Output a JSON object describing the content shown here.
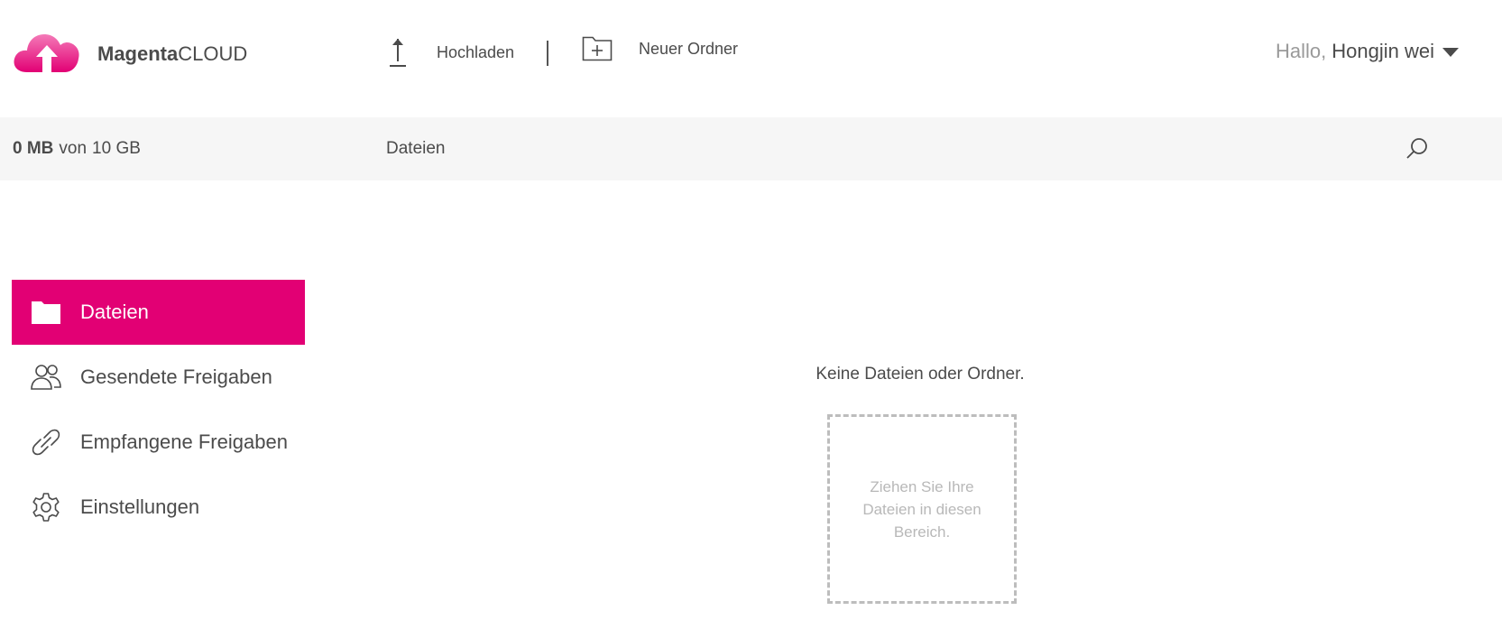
{
  "brand": {
    "name_bold": "Magenta",
    "name_light": "CLOUD",
    "accent_color": "#e20074",
    "logo_icon": "cloud-upload-icon"
  },
  "toolbar": {
    "upload_label": "Hochladen",
    "upload_icon": "upload-arrow-icon",
    "new_folder_label": "Neuer Ordner",
    "new_folder_icon": "folder-plus-icon"
  },
  "user": {
    "greeting": "Hallo,",
    "name": "Hongjin wei",
    "menu_icon": "caret-down-icon"
  },
  "quota": {
    "used": "0 MB",
    "of": "von",
    "total": "10 GB"
  },
  "breadcrumb": {
    "current": "Dateien"
  },
  "search": {
    "icon": "search-icon"
  },
  "sidebar": {
    "items": [
      {
        "label": "Dateien",
        "icon": "folder-icon",
        "active": true
      },
      {
        "label": "Gesendete Freigaben",
        "icon": "users-icon",
        "active": false
      },
      {
        "label": "Empfangene Freigaben",
        "icon": "link-icon",
        "active": false
      },
      {
        "label": "Einstellungen",
        "icon": "gear-icon",
        "active": false
      }
    ]
  },
  "main": {
    "empty_message": "Keine Dateien oder Ordner.",
    "dropzone_text": "Ziehen Sie Ihre Dateien in diesen Bereich."
  }
}
